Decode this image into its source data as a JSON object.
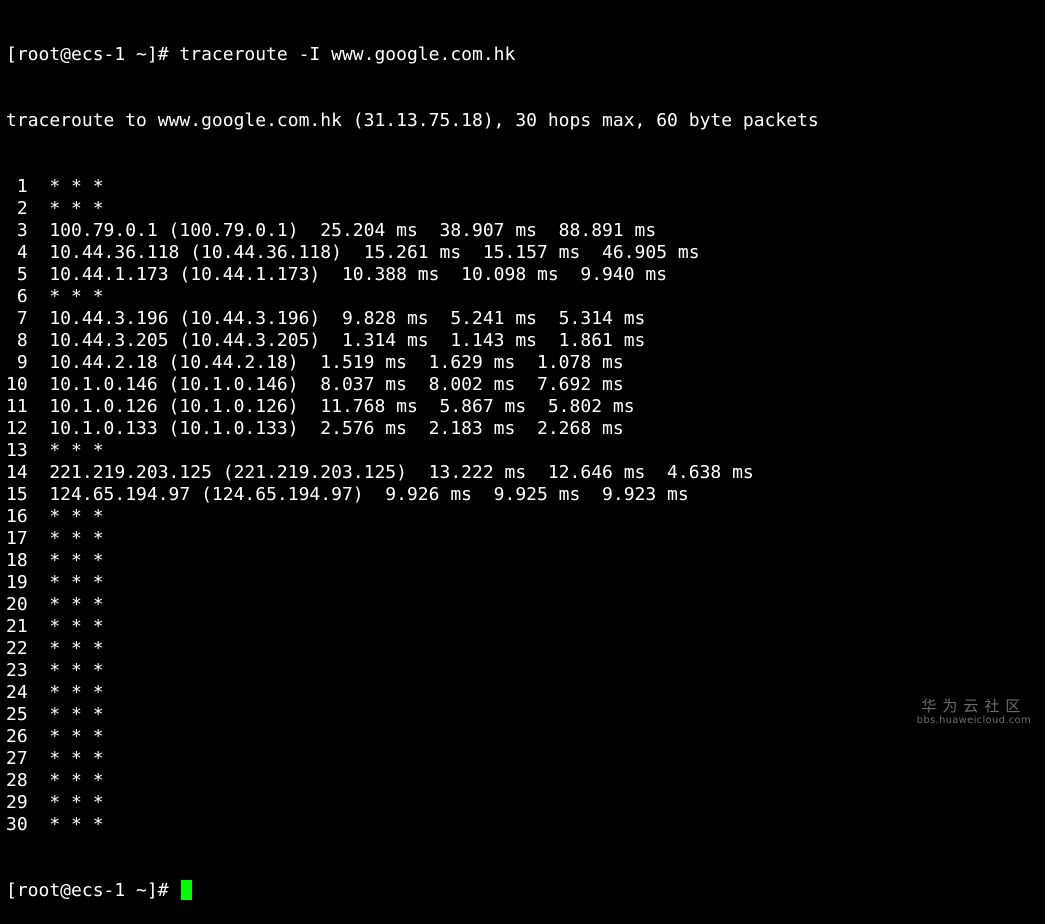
{
  "terminal": {
    "prompt": "[root@ecs-1 ~]# ",
    "command": "traceroute -I www.google.com.hk",
    "header": "traceroute to www.google.com.hk (31.13.75.18), 30 hops max, 60 byte packets",
    "hops": [
      " 1  * * *",
      " 2  * * *",
      " 3  100.79.0.1 (100.79.0.1)  25.204 ms  38.907 ms  88.891 ms",
      " 4  10.44.36.118 (10.44.36.118)  15.261 ms  15.157 ms  46.905 ms",
      " 5  10.44.1.173 (10.44.1.173)  10.388 ms  10.098 ms  9.940 ms",
      " 6  * * *",
      " 7  10.44.3.196 (10.44.3.196)  9.828 ms  5.241 ms  5.314 ms",
      " 8  10.44.3.205 (10.44.3.205)  1.314 ms  1.143 ms  1.861 ms",
      " 9  10.44.2.18 (10.44.2.18)  1.519 ms  1.629 ms  1.078 ms",
      "10  10.1.0.146 (10.1.0.146)  8.037 ms  8.002 ms  7.692 ms",
      "11  10.1.0.126 (10.1.0.126)  11.768 ms  5.867 ms  5.802 ms",
      "12  10.1.0.133 (10.1.0.133)  2.576 ms  2.183 ms  2.268 ms",
      "13  * * *",
      "14  221.219.203.125 (221.219.203.125)  13.222 ms  12.646 ms  4.638 ms",
      "15  124.65.194.97 (124.65.194.97)  9.926 ms  9.925 ms  9.923 ms",
      "16  * * *",
      "17  * * *",
      "18  * * *",
      "19  * * *",
      "20  * * *",
      "21  * * *",
      "22  * * *",
      "23  * * *",
      "24  * * *",
      "25  * * *",
      "26  * * *",
      "27  * * *",
      "28  * * *",
      "29  * * *",
      "30  * * *"
    ],
    "final_prompt": "[root@ecs-1 ~]# "
  },
  "colors": {
    "background": "#000000",
    "foreground": "#ffffff",
    "cursor": "#00ff00",
    "watermark": "#6b6b6b"
  },
  "watermark": {
    "title": "华为云社区",
    "url": "bbs.huaweicloud.com"
  }
}
